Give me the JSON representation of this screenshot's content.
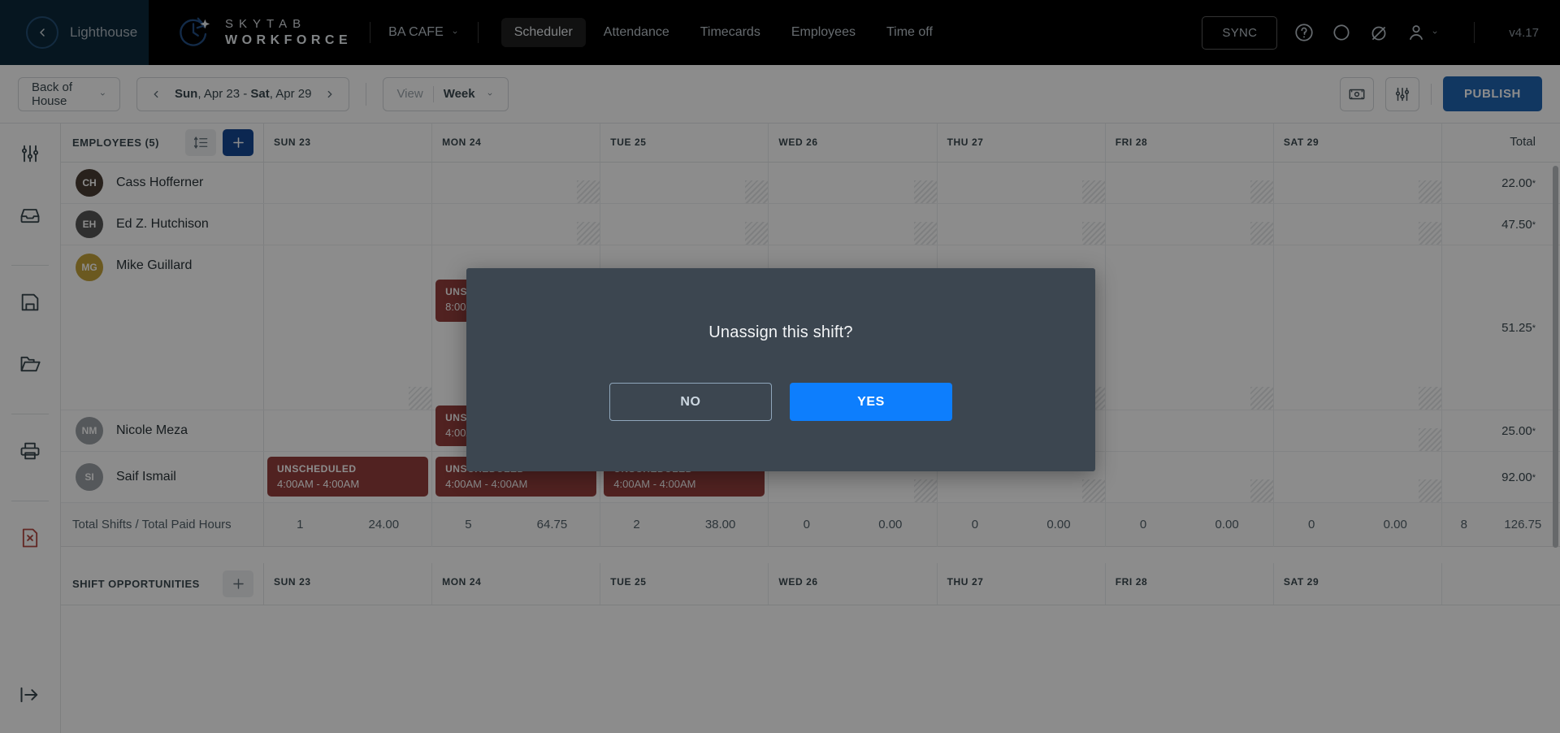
{
  "topnav": {
    "back_label": "Lighthouse",
    "brand_top": "SKYTAB",
    "brand_bottom": "WORKFORCE",
    "venue": "BA CAFE",
    "links": [
      {
        "label": "Scheduler",
        "active": true
      },
      {
        "label": "Attendance",
        "active": false
      },
      {
        "label": "Timecards",
        "active": false
      },
      {
        "label": "Employees",
        "active": false
      },
      {
        "label": "Time off",
        "active": false
      }
    ],
    "sync_label": "SYNC",
    "icons": [
      "help-icon",
      "chat-icon",
      "notification-icon",
      "user-icon"
    ],
    "version": "v4.17"
  },
  "toolbar": {
    "department": "Back of House",
    "date_range_day_start": "Sun",
    "date_range_rest_start": ", Apr 23 - ",
    "date_range_day_end": "Sat",
    "date_range_rest_end": ", Apr 29",
    "view_label": "View",
    "view_value": "Week",
    "publish_label": "PUBLISH",
    "icons": [
      "cash-drawer-icon",
      "filter-sliders-icon"
    ]
  },
  "leftrail": {
    "icons": [
      "sliders-icon",
      "inbox-icon",
      "save-icon",
      "folder-icon",
      "print-icon",
      "delete-file-icon",
      "collapse-icon"
    ]
  },
  "grid": {
    "employees_header": "EMPLOYEES (5)",
    "total_header": "Total",
    "days": [
      "SUN 23",
      "MON 24",
      "TUE 25",
      "WED 26",
      "THU 27",
      "FRI 28",
      "SAT 29"
    ],
    "employees": [
      {
        "name": "Cass Hofferner",
        "initials": "CH",
        "avatar_color": "#4a3b32",
        "total": "22.00",
        "sup": "*"
      },
      {
        "name": "Ed Z. Hutchison",
        "initials": "EH",
        "avatar_color": "#565656",
        "total": "47.50",
        "sup": "*"
      },
      {
        "name": "Mike Guillard",
        "initials": "MG",
        "avatar_color": "#c9a227",
        "total": "51.25",
        "sup": "*"
      },
      {
        "name": "Nicole Meza",
        "initials": "NM",
        "avatar_color": "#9aa0a6",
        "total": "25.00",
        "sup": "*"
      },
      {
        "name": "Saif Ismail",
        "initials": "SI",
        "avatar_color": "#9aa0a6",
        "total": "92.00",
        "sup": "*"
      }
    ],
    "shifts": [
      {
        "row": 3,
        "day": 1,
        "title": "UNSCHEDULED",
        "time": "8:00AM - 4:00AM"
      },
      {
        "row": 4,
        "day": 0,
        "title": "UNSCHEDULED",
        "time": "4:00AM - 4:00AM"
      },
      {
        "row": 4,
        "day": 1,
        "title": "UNSCHEDULED",
        "time": "4:00AM - 4:00AM"
      },
      {
        "row": 4,
        "day": 2,
        "title": "UNSCHEDULED",
        "time": "4:00AM - 4:00AM"
      }
    ],
    "totals_label": "Total Shifts / Total Paid Hours",
    "totals_by_day": [
      {
        "shifts": "1",
        "hours": "24.00"
      },
      {
        "shifts": "5",
        "hours": "64.75"
      },
      {
        "shifts": "2",
        "hours": "38.00"
      },
      {
        "shifts": "0",
        "hours": "0.00"
      },
      {
        "shifts": "0",
        "hours": "0.00"
      },
      {
        "shifts": "0",
        "hours": "0.00"
      },
      {
        "shifts": "0",
        "hours": "0.00"
      }
    ],
    "totals_grand": {
      "shifts": "8",
      "hours": "126.75"
    },
    "opportunities_header": "SHIFT OPPORTUNITIES"
  },
  "modal": {
    "title": "Unassign this shift?",
    "no_label": "NO",
    "yes_label": "YES"
  },
  "colors": {
    "brand_navy": "#06293f",
    "accent_blue": "#1565c0",
    "primary_blue": "#0d47a1",
    "shift_red": "#a03a38",
    "modal_bg": "#3c4650",
    "modal_yes": "#0d7efd"
  }
}
